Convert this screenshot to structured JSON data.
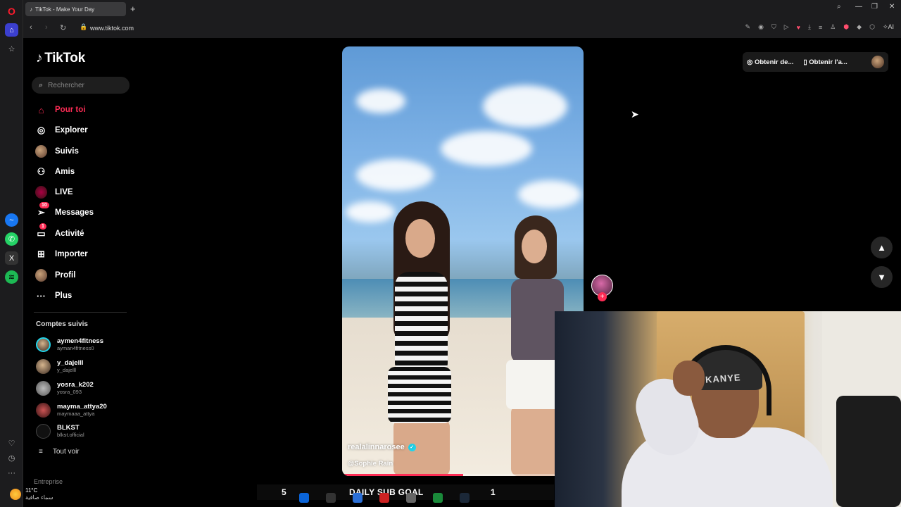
{
  "browser": {
    "tab_title": "TikTok - Make Your Day",
    "url": "www.tiktok.com",
    "new_tab_icon": "+",
    "ai_label": "AI"
  },
  "sidebar": {
    "logo_text": "TikTok",
    "search_placeholder": "Rechercher",
    "nav": [
      {
        "label": "Pour toi",
        "icon": "home-icon",
        "active": true
      },
      {
        "label": "Explorer",
        "icon": "compass-icon"
      },
      {
        "label": "Suivis",
        "icon": "following-avatar-icon"
      },
      {
        "label": "Amis",
        "icon": "friends-icon"
      },
      {
        "label": "LIVE",
        "icon": "live-icon"
      },
      {
        "label": "Messages",
        "icon": "messages-icon",
        "badge": "10"
      },
      {
        "label": "Activité",
        "icon": "activity-icon",
        "badge": "1"
      },
      {
        "label": "Importer",
        "icon": "upload-icon"
      },
      {
        "label": "Profil",
        "icon": "profile-avatar-icon"
      },
      {
        "label": "Plus",
        "icon": "more-icon"
      }
    ],
    "followed_title": "Comptes suivis",
    "followed": [
      {
        "name": "aymen4fitness",
        "handle": "ayman4fitness0"
      },
      {
        "name": "y_dajelll",
        "handle": "y_dajelll"
      },
      {
        "name": "yosra_k202",
        "handle": "yosra_093"
      },
      {
        "name": "mayma_attya20",
        "handle": "maymaaa_attya"
      },
      {
        "name": "BLKST",
        "handle": "blkst.official"
      }
    ],
    "see_all": "Tout voir",
    "footer_section": "Entreprise"
  },
  "video": {
    "username": "realalinnarosee",
    "caption": "@Sophie Rain",
    "progress": 0.5
  },
  "top_actions": {
    "coins_label": "Obtenir de...",
    "app_label": "Obtenir l'a..."
  },
  "nav_buttons": {
    "up": "▲",
    "down": "▼"
  },
  "overlay": {
    "goal_left": "5",
    "goal_title": "DAILY SUB GOAL",
    "goal_right": "1",
    "webcam_cap_text": "KANYE"
  },
  "taskbar": {
    "temperature": "11°C",
    "condition": "سماء صافية"
  },
  "colors": {
    "accent": "#fe2c55",
    "verified": "#20d5ec",
    "opera_red": "#ff1b2d"
  }
}
